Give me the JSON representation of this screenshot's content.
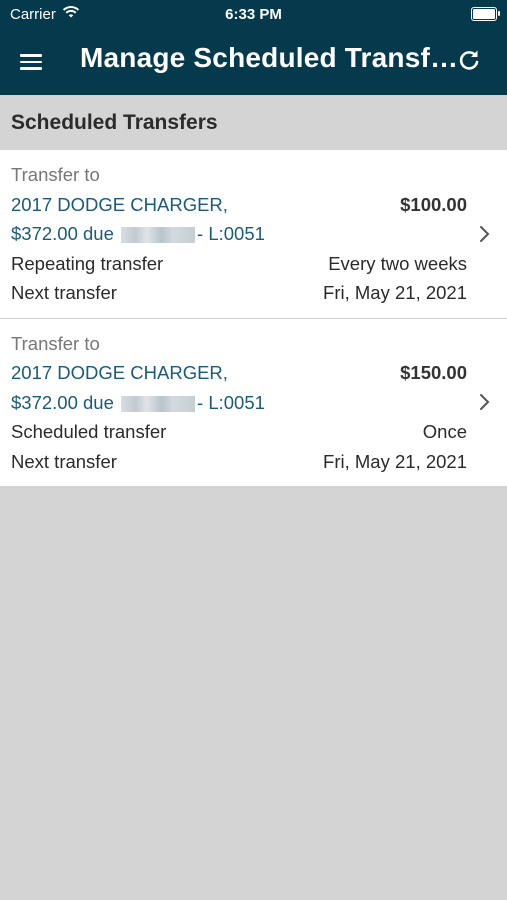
{
  "status_bar": {
    "carrier": "Carrier",
    "time": "6:33 PM"
  },
  "header": {
    "title": "Manage Scheduled Transf…"
  },
  "section": {
    "title": "Scheduled Transfers"
  },
  "transfers": [
    {
      "label": "Transfer to",
      "account": "2017 DODGE CHARGER,",
      "amount": "$100.00",
      "due_prefix": "$372.00 due",
      "due_suffix": "- L:0051",
      "type_label": "Repeating transfer",
      "type_value": "Every two weeks",
      "next_label": "Next transfer",
      "next_value": "Fri, May 21, 2021"
    },
    {
      "label": "Transfer to",
      "account": "2017 DODGE CHARGER,",
      "amount": "$150.00",
      "due_prefix": "$372.00 due",
      "due_suffix": "- L:0051",
      "type_label": "Scheduled transfer",
      "type_value": "Once",
      "next_label": "Next transfer",
      "next_value": "Fri, May 21, 2021"
    }
  ],
  "colors": {
    "header_bg": "#053a4d",
    "link": "#1a5b7a",
    "background": "#d4d4d4"
  },
  "icons": [
    "wifi-icon",
    "battery-icon",
    "menu-icon",
    "refresh-icon",
    "chevron-right-icon"
  ]
}
